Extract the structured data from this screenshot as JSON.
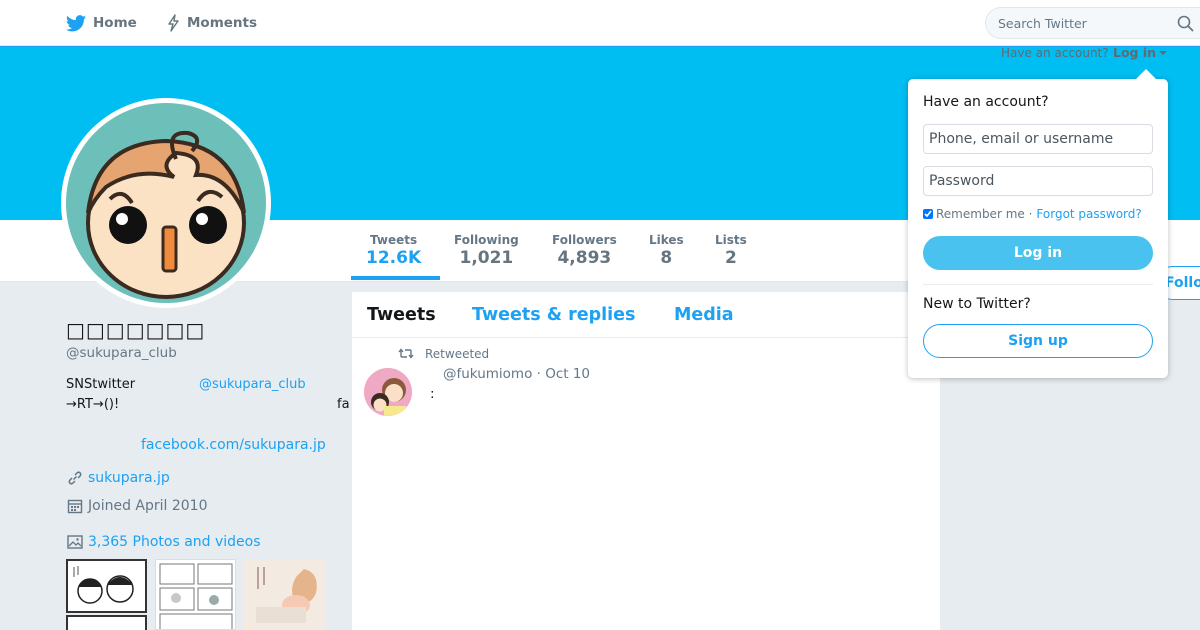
{
  "nav": {
    "home_label": "Home",
    "moments_label": "Moments",
    "search_placeholder": "Search Twitter"
  },
  "account_bar": {
    "prompt": "Have an account?",
    "login_label": "Log in"
  },
  "profile": {
    "name": "□□□□□□□",
    "handle": "@sukupara_club",
    "bio": {
      "line1_text": "SNStwitter",
      "line1_mention": "@sukupara_club",
      "line2_text": "→RT→()!",
      "line2_tail": "fa",
      "link": "facebook.com/sukupara.jp"
    },
    "website": "sukupara.jp",
    "joined": "Joined April 2010",
    "photos_label": "3,365 Photos and videos"
  },
  "stats": [
    {
      "label": "Tweets",
      "value": "12.6K"
    },
    {
      "label": "Following",
      "value": "1,021"
    },
    {
      "label": "Followers",
      "value": "4,893"
    },
    {
      "label": "Likes",
      "value": "8"
    },
    {
      "label": "Lists",
      "value": "2"
    }
  ],
  "follow_label": "Follo",
  "tabs": [
    "Tweets",
    "Tweets & replies",
    "Media"
  ],
  "tweet": {
    "retweet_label": "Retweeted",
    "meta": "@fukumiomo · Oct 10",
    "text": ":"
  },
  "login_dropdown": {
    "heading": "Have an account?",
    "username_placeholder": "Phone, email or username",
    "password_placeholder": "Password",
    "remember_label": "Remember me ·",
    "forgot_label": "Forgot password?",
    "login_button": "Log in",
    "new_prompt": "New to Twitter?",
    "signup_button": "Sign up"
  },
  "colors": {
    "brand": "#1da1f2",
    "banner": "#00bdf2",
    "page_bg": "#e6ecf0"
  }
}
